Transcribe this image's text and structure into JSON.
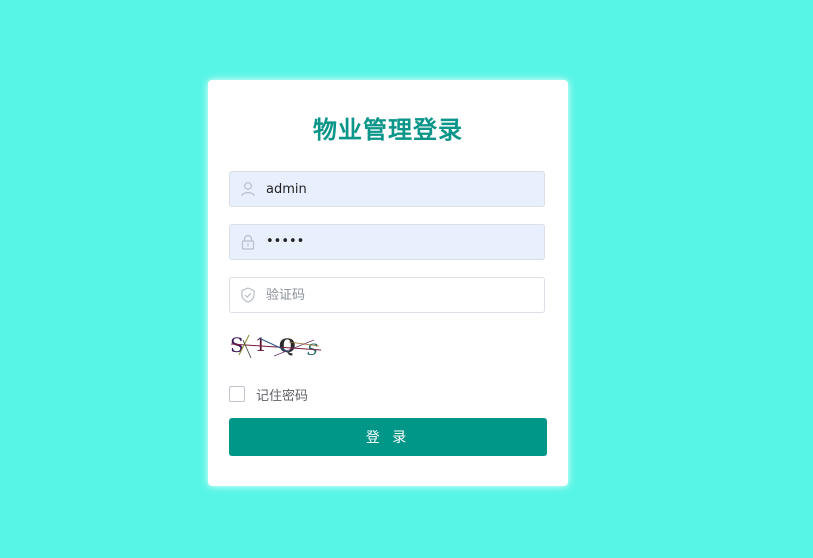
{
  "title": "物业管理登录",
  "username": {
    "value": "admin",
    "icon": "user-icon"
  },
  "password": {
    "masked": "•••••",
    "icon": "lock-icon"
  },
  "captcha_input": {
    "placeholder": "验证码",
    "icon": "shield-check-icon"
  },
  "captcha_image": {
    "text": "S1QS"
  },
  "remember": {
    "label": "记住密码",
    "checked": false
  },
  "login_button": {
    "label": "登 录"
  },
  "colors": {
    "background": "#57f5e6",
    "accent": "#009688",
    "title": "#0c968a",
    "autofill": "#e8f0fe"
  }
}
